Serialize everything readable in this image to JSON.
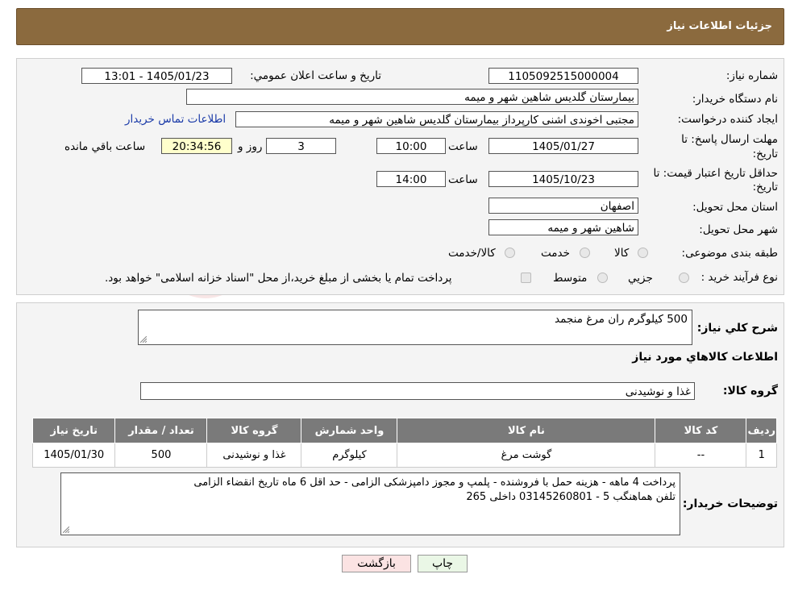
{
  "header": {
    "title": "جزئیات اطلاعات نیاز"
  },
  "form": {
    "need_number_label": "شماره نیاز:",
    "need_number": "1105092515000004",
    "announce_label": "تاریخ و ساعت اعلان عمومي:",
    "announce_value": "1405/01/23 - 13:01",
    "buyer_org_label": "نام دستگاه خریدار:",
    "buyer_org": "بیمارستان گلدیس  شاهین شهر و میمه",
    "creator_label": "ایجاد کننده درخواست:",
    "creator": "مجتبی اخوندی اشنی کارپرداز بیمارستان گلدیس  شاهین شهر و میمه",
    "contact_link": "اطلاعات تماس خریدار",
    "deadline_label_1": "مهلت ارسال پاسخ: تا",
    "deadline_label_2": "تاریخ:",
    "deadline_date": "1405/01/27",
    "time_label": "ساعت",
    "deadline_time": "10:00",
    "days_value": "3",
    "days_label": "روز و",
    "remaining_time": "20:34:56",
    "remaining_label": "ساعت باقي مانده",
    "validity_label_1": "حداقل تاریخ اعتبار قیمت: تا",
    "validity_label_2": "تاریخ:",
    "validity_date": "1405/10/23",
    "validity_time": "14:00",
    "province_label": "استان محل تحویل:",
    "province": "اصفهان",
    "city_label": "شهر محل تحویل:",
    "city": "شاهین شهر و میمه",
    "category_label": "طبقه بندی موضوعی:",
    "category_options": [
      "کالا",
      "خدمت",
      "کالا/خدمت"
    ],
    "process_label": "نوع فرآیند خرید :",
    "process_options": [
      "جزیي",
      "متوسط"
    ],
    "process_note": "پرداخت تمام یا بخشی از مبلغ خرید،از محل \"اسناد خزانه اسلامی\" خواهد بود."
  },
  "details": {
    "summary_label": "شرح کلي نیاز:",
    "summary": "500 کیلوگرم ران مرغ منجمد",
    "goods_title": "اطلاعات کالاهاي مورد نیاز",
    "group_label": "گروه کالا:",
    "group_value": "غذا و نوشیدنی",
    "table": {
      "headers": [
        "ردیف",
        "کد کالا",
        "نام کالا",
        "واحد شمارش",
        "گروه کالا",
        "تعداد / مقدار",
        "تاریخ نیاز"
      ],
      "rows": [
        [
          "1",
          "--",
          "گوشت مرغ",
          "کیلوگرم",
          "غذا و نوشیدنی",
          "500",
          "1405/01/30"
        ]
      ]
    },
    "notes_label": "توضیحات خریدار:",
    "notes_line1": "پرداخت 4 ماهه - هزینه حمل با فروشنده - پلمپ و مجوز دامپزشکی الزامی - حد اقل 6 ماه تاریخ انقضاء الزامی",
    "notes_line2": "تلفن هماهنگب 5 - 03145260801 داخلی 265"
  },
  "buttons": {
    "print": "چاپ",
    "back": "بازگشت"
  },
  "colors": {
    "header": "#8b6a3e",
    "remaining_bg": "#ffffcc",
    "table_header": "#7a7a7a",
    "print_bg": "#eaf7e6",
    "back_bg": "#fbe3e3"
  }
}
